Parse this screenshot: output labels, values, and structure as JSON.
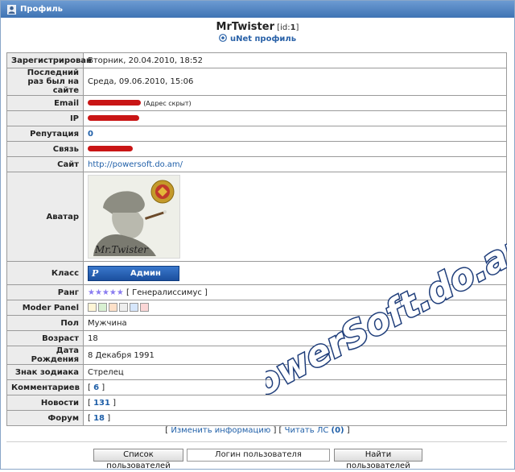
{
  "window": {
    "title": "Профиль"
  },
  "header": {
    "nick": "MrTwister",
    "id_prefix": "[id:",
    "id_value": "1",
    "id_suffix": "]",
    "unet_label": "uNet профиль"
  },
  "rows": {
    "registered": {
      "label": "Зарегистрирован",
      "value": "Вторник, 20.04.2010, 18:52"
    },
    "last_visit": {
      "label": "Последний раз был на сайте",
      "value": "Среда, 09.06.2010, 15:06"
    },
    "email": {
      "label": "Email",
      "note": "(Адрес скрыт)"
    },
    "ip": {
      "label": "IP"
    },
    "reputation": {
      "label": "Репутация",
      "value": "0"
    },
    "contact": {
      "label": "Связь"
    },
    "site": {
      "label": "Сайт",
      "value": "http://powersoft.do.am/"
    },
    "avatar": {
      "label": "Аватар",
      "caption": "Mr.Twister"
    },
    "class": {
      "label": "Класс",
      "badge_letter": "P",
      "value": "Админ"
    },
    "rank": {
      "label": "Ранг",
      "stars": "★★★★★",
      "value": "[ Генералиссимус ]",
      "stars_count": 5
    },
    "moder_panel": {
      "label": "Moder Panel"
    },
    "gender": {
      "label": "Пол",
      "value": "Мужчина"
    },
    "age": {
      "label": "Возраст",
      "value": "18"
    },
    "birthday": {
      "label": "Дата Рождения",
      "value": "8 Декабря 1991"
    },
    "zodiac": {
      "label": "Знак зодиака",
      "value": "Стрелец"
    },
    "comments": {
      "label": "Комментариев",
      "value": "6"
    },
    "news": {
      "label": "Новости",
      "value": "131"
    },
    "forum": {
      "label": "Форум",
      "value": "18"
    }
  },
  "footer": {
    "edit_info": "Изменить информацию",
    "read_pm": "Читать ЛС",
    "read_pm_count": "(0)",
    "user_list_button": "Список пользователей",
    "login_input_value": "Логин пользователя",
    "find_users_button": "Найти пользователей"
  },
  "watermark": {
    "text": "PowerSoft.do.am"
  },
  "colors": {
    "titlebar": "#4a7fc1",
    "link": "#1f5fa8",
    "label_bg": "#ececec",
    "redaction": "#c91515",
    "badge": "#2a64b8",
    "stars": "#8a7cf0"
  }
}
